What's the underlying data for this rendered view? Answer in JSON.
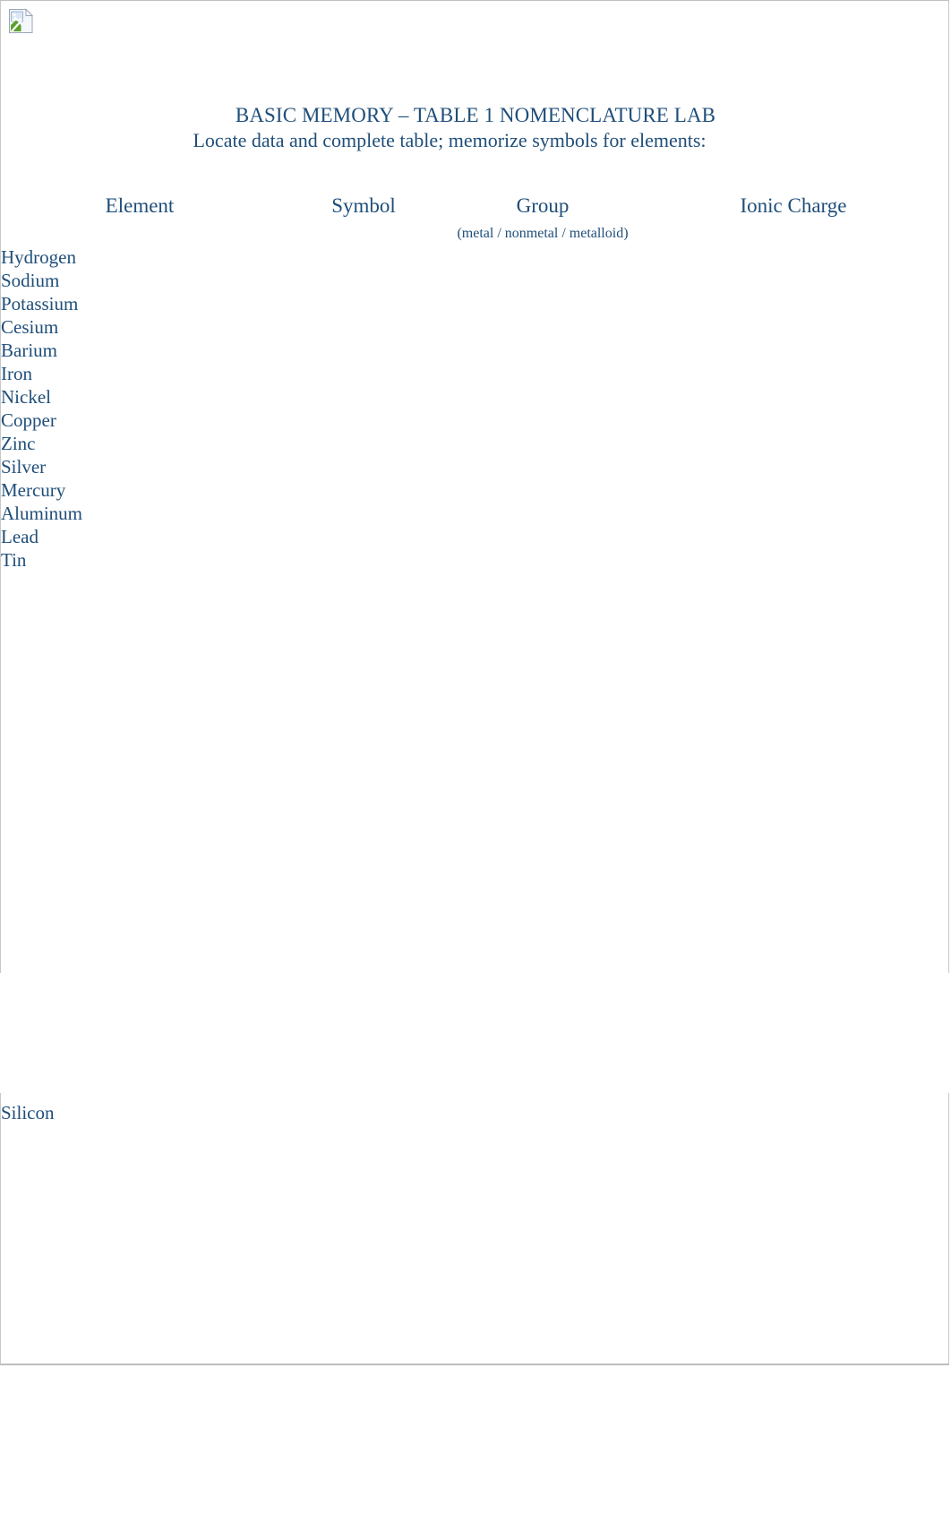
{
  "document": {
    "title": "BASIC MEMORY – TABLE 1 NOMENCLATURE LAB",
    "subtitle": "Locate data and complete table; memorize symbols for elements:",
    "text_color": "#1F4E79",
    "page_border_color": "#c8c8c8",
    "background_color": "#ffffff"
  },
  "broken_image": {
    "icon": "broken-image-placeholder"
  },
  "table": {
    "columns": [
      {
        "label": "Element",
        "sub": ""
      },
      {
        "label": "Symbol",
        "sub": ""
      },
      {
        "label": "Group",
        "sub": "(metal / nonmetal / metalloid)"
      },
      {
        "label": "Ionic Charge",
        "sub": ""
      }
    ],
    "rows": [
      {
        "element": "Hydrogen",
        "symbol": "",
        "group": "",
        "ionic_charge": ""
      },
      {
        "element": "Sodium",
        "symbol": "",
        "group": "",
        "ionic_charge": ""
      },
      {
        "element": "Potassium",
        "symbol": "",
        "group": "",
        "ionic_charge": ""
      },
      {
        "element": "Cesium",
        "symbol": "",
        "group": "",
        "ionic_charge": ""
      },
      {
        "element": "Barium",
        "symbol": "",
        "group": "",
        "ionic_charge": ""
      },
      {
        "element": "Iron",
        "symbol": "",
        "group": "",
        "ionic_charge": ""
      },
      {
        "element": "Nickel",
        "symbol": "",
        "group": "",
        "ionic_charge": ""
      },
      {
        "element": "Copper",
        "symbol": "",
        "group": "",
        "ionic_charge": ""
      },
      {
        "element": "Zinc",
        "symbol": "",
        "group": "",
        "ionic_charge": ""
      },
      {
        "element": "Silver",
        "symbol": "",
        "group": "",
        "ionic_charge": ""
      },
      {
        "element": "Mercury",
        "symbol": "",
        "group": "",
        "ionic_charge": ""
      },
      {
        "element": "Aluminum",
        "symbol": "",
        "group": "",
        "ionic_charge": ""
      },
      {
        "element": "Lead",
        "symbol": "",
        "group": "",
        "ionic_charge": ""
      },
      {
        "element": "Tin",
        "symbol": "",
        "group": "",
        "ionic_charge": ""
      }
    ],
    "rows_continued": [
      {
        "element": "Silicon",
        "symbol": "",
        "group": "",
        "ionic_charge": ""
      }
    ]
  }
}
